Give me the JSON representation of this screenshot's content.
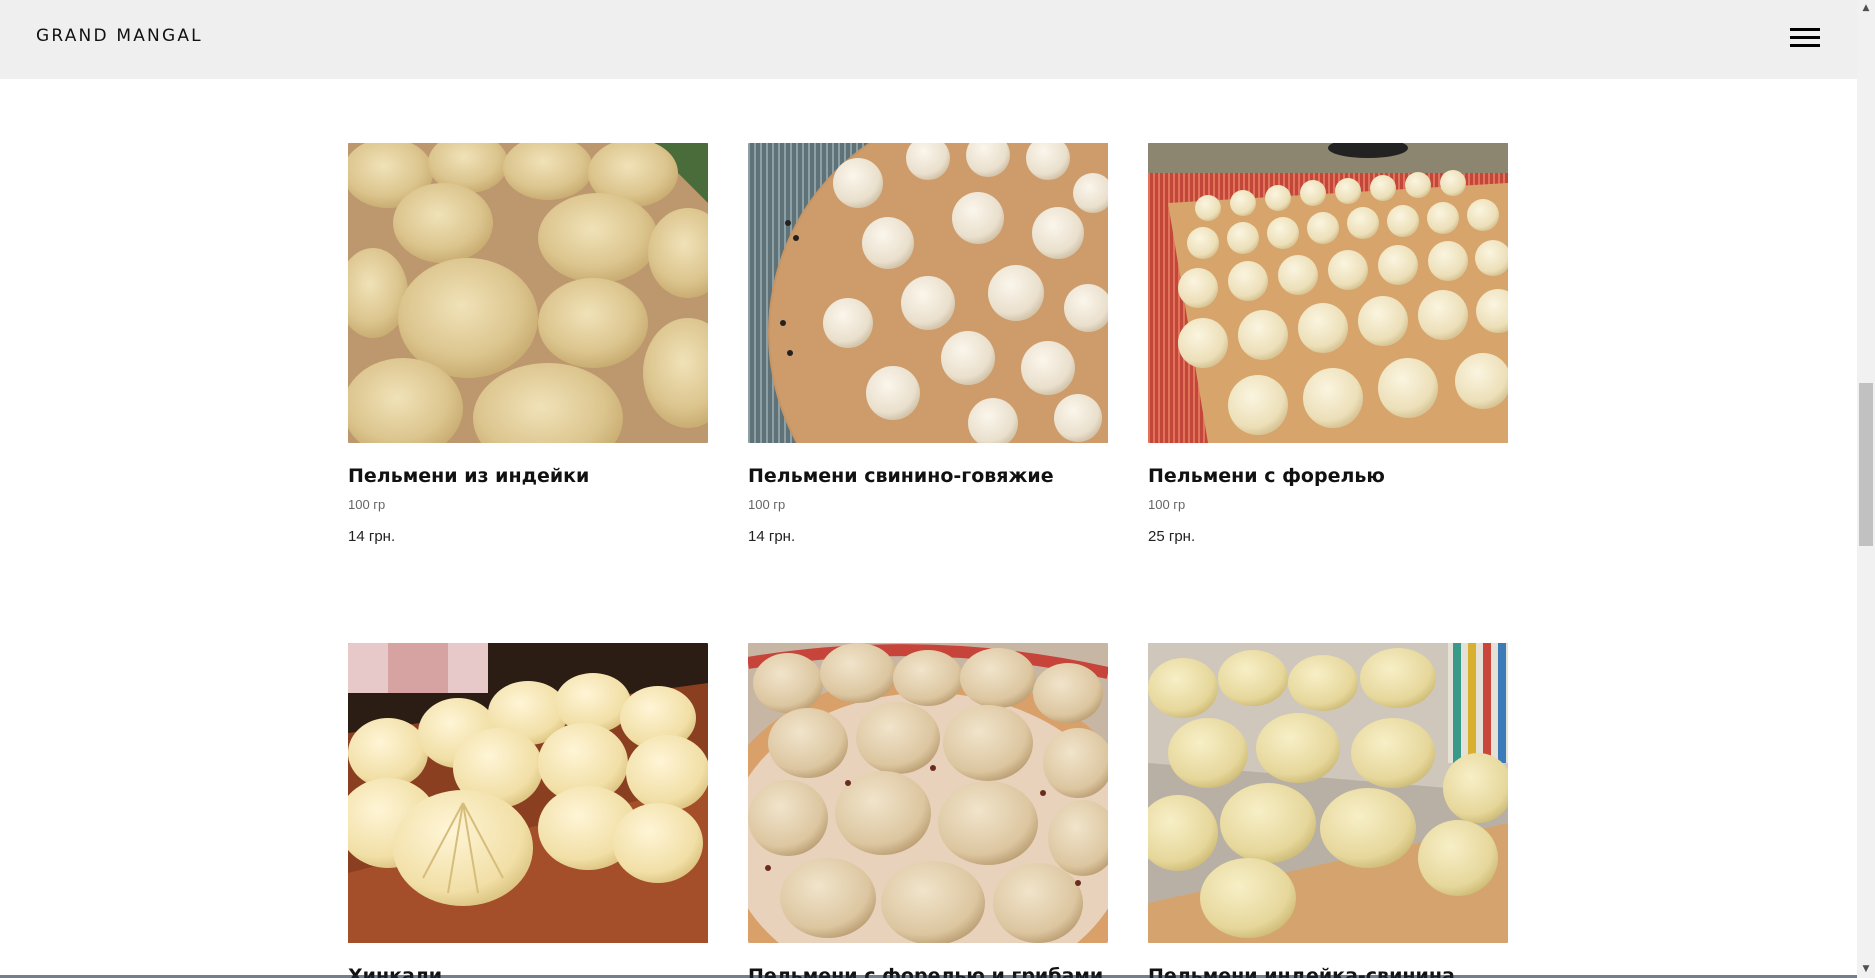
{
  "header": {
    "logo": "GRAND MANGAL",
    "menu_icon": "hamburger-menu-icon"
  },
  "products": [
    {
      "title": "Пельмени из индейки",
      "weight": "100 гр",
      "price": "14 грн.",
      "image": "turkey-dumplings-photo"
    },
    {
      "title": "Пельмени свинино-говяжие",
      "weight": "100 гр",
      "price": "14 грн.",
      "image": "pork-beef-dumplings-photo"
    },
    {
      "title": "Пельмени с форелью",
      "weight": "100 гр",
      "price": "25 грн.",
      "image": "trout-dumplings-photo"
    },
    {
      "title": "Хинкали",
      "image": "khinkali-photo"
    },
    {
      "title": "Пельмени с форелью и грибами",
      "image": "trout-mushroom-dumplings-photo"
    },
    {
      "title": "Пельмени индейка-свинина",
      "image": "turkey-pork-dumplings-photo"
    }
  ],
  "scrollbar": {
    "up_icon": "scroll-up-arrow-icon",
    "down_icon": "scroll-down-arrow-icon"
  }
}
